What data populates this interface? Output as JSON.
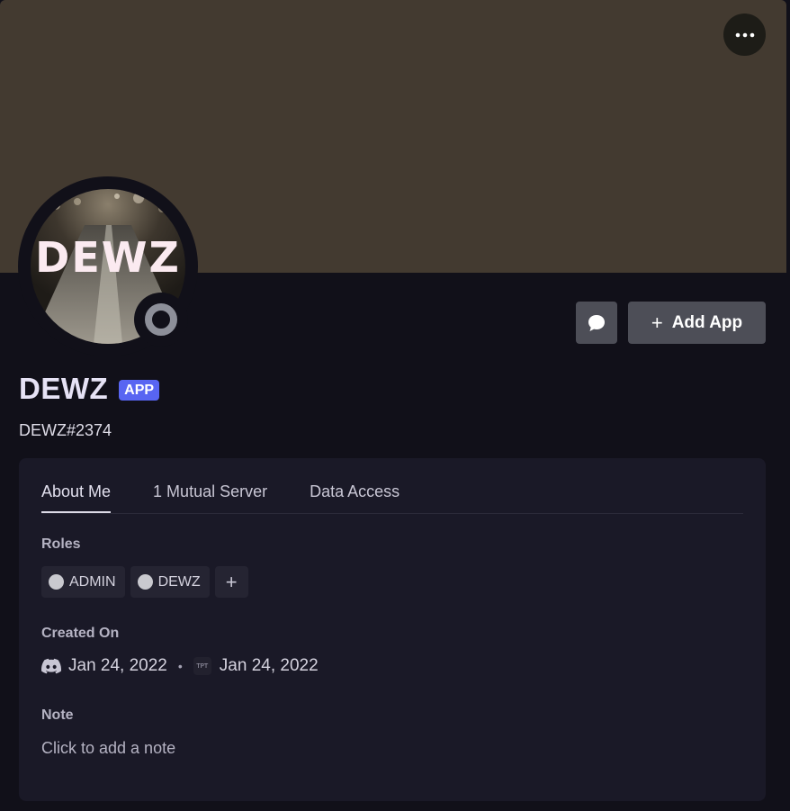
{
  "profile": {
    "avatar_text": "DEWZ",
    "display_name": "DEWZ",
    "badge": "APP",
    "tag": "DEWZ#2374"
  },
  "actions": {
    "add_app_label": "Add App",
    "add_app_icon": "plus-icon",
    "message_icon": "chat-bubble-icon",
    "more_icon": "more-horizontal-icon"
  },
  "tabs": [
    {
      "label": "About Me",
      "active": true
    },
    {
      "label": "1 Mutual Server",
      "active": false
    },
    {
      "label": "Data Access",
      "active": false
    }
  ],
  "about": {
    "roles_label": "Roles",
    "roles": [
      {
        "name": "ADMIN",
        "color": "#c9c9cf"
      },
      {
        "name": "DEWZ",
        "color": "#c9c9cf"
      }
    ],
    "created_label": "Created On",
    "created_discord": "Jan 24, 2022",
    "server_icon_text": "TPT",
    "created_server": "Jan 24, 2022",
    "note_label": "Note",
    "note_placeholder": "Click to add a note"
  },
  "colors": {
    "banner": "#433a30",
    "background": "#111019",
    "card": "#1a1927",
    "badge": "#5865f2",
    "button": "#4d4e57"
  }
}
